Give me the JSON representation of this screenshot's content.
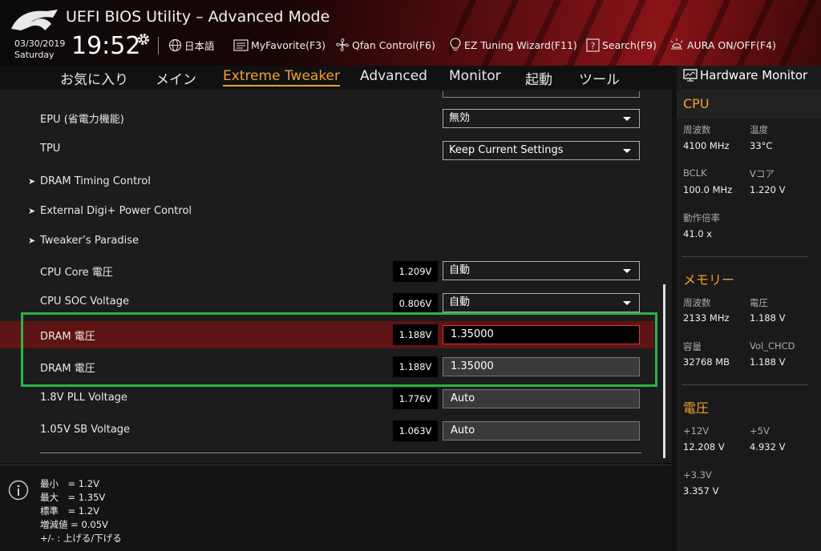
{
  "header": {
    "title": "UEFI BIOS Utility – Advanced Mode",
    "date": "03/30/2019",
    "day": "Saturday",
    "time": "19:52",
    "toolbar": {
      "language": "日本語",
      "myfavorite": "MyFavorite(F3)",
      "qfan": "Qfan Control(F6)",
      "ez_tuning": "EZ Tuning Wizard(F11)",
      "search": "Search(F9)",
      "aura": "AURA ON/OFF(F4)"
    }
  },
  "tabs": [
    "お気に入り",
    "メイン",
    "Extreme Tweaker",
    "Advanced",
    "Monitor",
    "起動",
    "ツール"
  ],
  "settings": {
    "epu": {
      "label": "EPU (省電力機能)",
      "value": "無効"
    },
    "tpu": {
      "label": "TPU",
      "value": "Keep Current Settings"
    },
    "dram_timing": {
      "label": "DRAM Timing Control"
    },
    "digi_power": {
      "label": "External Digi+ Power Control"
    },
    "tweakers": {
      "label": "Tweaker’s Paradise"
    },
    "cpu_core": {
      "label": "CPU Core 電圧",
      "voltage": "1.209V",
      "value": "自動"
    },
    "cpu_soc": {
      "label": "CPU SOC Voltage",
      "voltage": "0.806V",
      "value": "自動"
    },
    "dram1": {
      "label": "DRAM 電圧",
      "voltage": "1.188V",
      "value": "1.35000"
    },
    "dram2": {
      "label": "DRAM 電圧",
      "voltage": "1.188V",
      "value": "1.35000"
    },
    "pll": {
      "label": "1.8V PLL Voltage",
      "voltage": "1.776V",
      "value": "Auto"
    },
    "sb": {
      "label": "1.05V SB Voltage",
      "voltage": "1.063V",
      "value": "Auto"
    }
  },
  "info": {
    "min": "最小　= 1.2V",
    "max": "最大　= 1.35V",
    "std": "標準　= 1.2V",
    "step": "増減値 = 0.05V",
    "keys": "+/- : 上げる/下げる"
  },
  "hw_monitor": {
    "title": "Hardware Monitor",
    "cpu": {
      "section": "CPU",
      "freq_label": "周波数",
      "freq": "4100 MHz",
      "temp_label": "温度",
      "temp": "33°C",
      "bclk_label": "BCLK",
      "bclk": "100.0 MHz",
      "vcore_label": "Vコア",
      "vcore": "1.220 V",
      "ratio_label": "動作倍率",
      "ratio": "41.0 x"
    },
    "memory": {
      "section": "メモリー",
      "freq_label": "周波数",
      "freq": "2133 MHz",
      "volt_label": "電圧",
      "volt": "1.188 V",
      "cap_label": "容量",
      "cap": "32768 MB",
      "vol_chcd_label": "Vol_CHCD",
      "vol_chcd": "1.188 V"
    },
    "voltage": {
      "section": "電圧",
      "p12_label": "+12V",
      "p12": "12.208 V",
      "p5_label": "+5V",
      "p5": "4.932 V",
      "p33_label": "+3.3V",
      "p33": "3.357 V"
    }
  },
  "colors": {
    "accent": "#f0a030",
    "highlight_box": "#2db34a",
    "selected_row": "#5e1414"
  }
}
